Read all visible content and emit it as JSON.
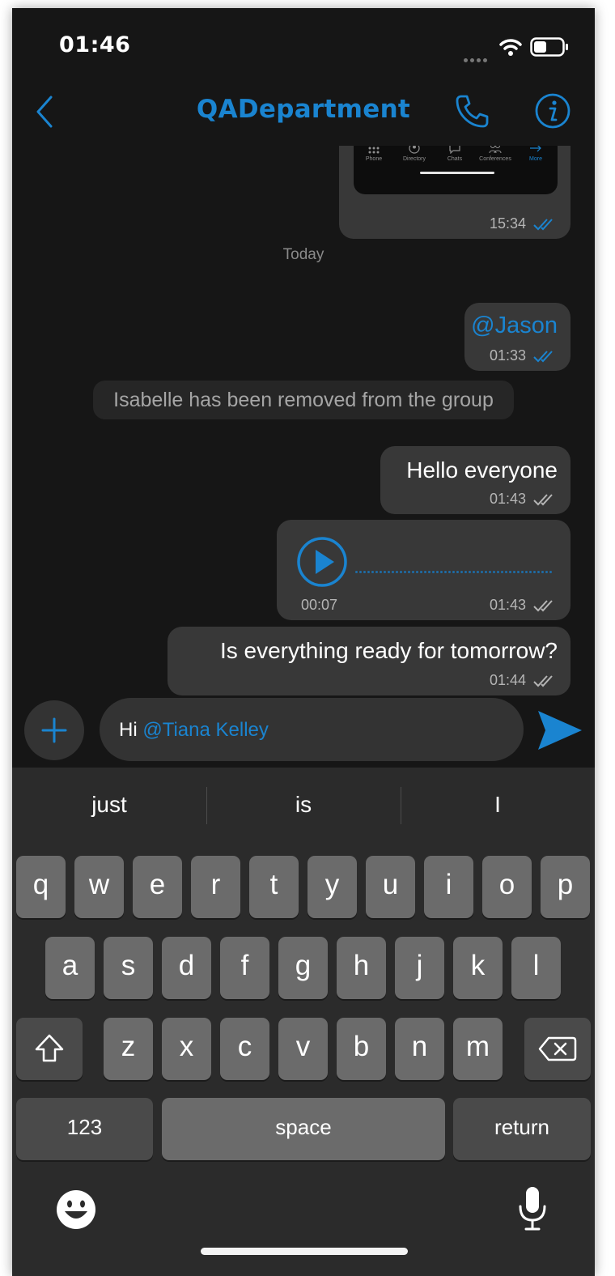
{
  "status_bar": {
    "time": "01:46"
  },
  "header": {
    "title": "QADepartment"
  },
  "chat": {
    "shared_screenshot": {
      "tabs": [
        "Phone",
        "Directory",
        "Chats",
        "Conferences",
        "More"
      ],
      "time": "15:34"
    },
    "day_separator": "Today",
    "messages": {
      "mention": {
        "text": "@Jason",
        "time": "01:33"
      },
      "system": "Isabelle has been removed from the group",
      "hello": {
        "text": "Hello everyone",
        "time": "01:43"
      },
      "voice": {
        "duration": "00:07",
        "time": "01:43"
      },
      "ready": {
        "text": "Is everything ready for tomorrow?",
        "time": "01:44"
      }
    }
  },
  "composer": {
    "text": "Hi ",
    "mention": "@Tiana Kelley"
  },
  "keyboard": {
    "suggestions": [
      "just",
      "is",
      "I"
    ],
    "row1": [
      "q",
      "w",
      "e",
      "r",
      "t",
      "y",
      "u",
      "i",
      "o",
      "p"
    ],
    "row2": [
      "a",
      "s",
      "d",
      "f",
      "g",
      "h",
      "j",
      "k",
      "l"
    ],
    "row3": [
      "z",
      "x",
      "c",
      "v",
      "b",
      "n",
      "m"
    ],
    "numbers_label": "123",
    "space_label": "space",
    "return_label": "return"
  },
  "colors": {
    "accent": "#1a84d0",
    "background": "#161616",
    "bubble": "#383838",
    "keyboard": "#2b2b2b"
  }
}
